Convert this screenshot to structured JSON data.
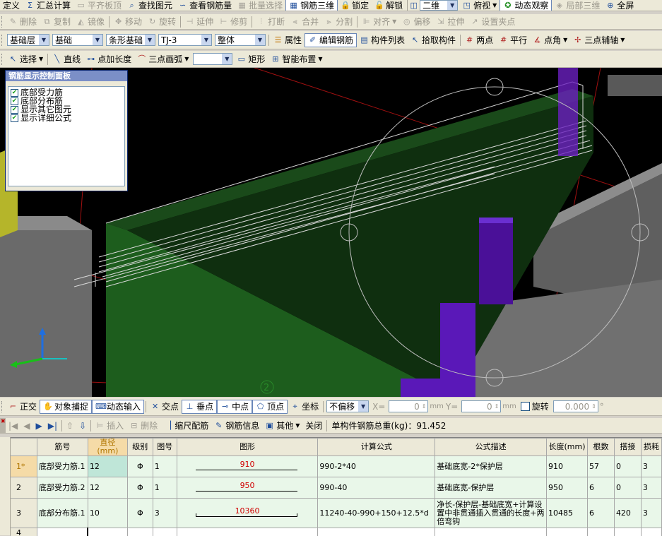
{
  "menu_toolbar": {
    "items": [
      "定义",
      "汇总计算",
      "平齐板顶",
      "查找图元",
      "查看钢筋量",
      "批量选择",
      "钢筋三维",
      "锁定",
      "解锁"
    ],
    "view_mode": "二维",
    "view_angle": "俯视",
    "dynamic_observe": "动态观察",
    "local_3d": "局部三维",
    "fullscreen": "全屏"
  },
  "edit_toolbar": {
    "items": [
      "删除",
      "复制",
      "镜像",
      "移动",
      "旋转",
      "延伸",
      "修剪",
      "打断",
      "合并",
      "分割",
      "对齐",
      "偏移",
      "拉伸",
      "设置夹点"
    ]
  },
  "property_toolbar": {
    "floor": "基础层",
    "category": "基础",
    "type": "条形基础",
    "member": "TJ-3",
    "scope": "整体",
    "items": [
      "属性",
      "编辑钢筋",
      "构件列表",
      "拾取构件",
      "两点",
      "平行",
      "点角",
      "三点辅轴"
    ]
  },
  "draw_toolbar": {
    "items": [
      "选择",
      "直线",
      "点加长度",
      "三点画弧",
      "矩形",
      "智能布置"
    ],
    "shape_select": ""
  },
  "panel": {
    "title": "钢筋显示控制面板",
    "items": [
      "底部受力筋",
      "底部分布筋",
      "显示其它图元",
      "显示详细公式"
    ]
  },
  "viewport": {
    "axis_label": "2"
  },
  "snap_toolbar": {
    "items": [
      "正交",
      "对象捕捉",
      "动态输入",
      "交点",
      "垂点",
      "中点",
      "顶点",
      "坐标"
    ],
    "offset_mode": "不偏移",
    "x_label": "X=",
    "x_value": "0",
    "y_label": "Y=",
    "y_value": "0",
    "unit": "mm",
    "rotate_label": "旋转",
    "rotate_value": "0.000",
    "degree": "°"
  },
  "rebar_toolbar": {
    "items": [
      "插入",
      "删除",
      "缩尺配筋",
      "钢筋信息",
      "其他",
      "关闭"
    ],
    "total_weight": "单构件钢筋总重(kg)：91.452"
  },
  "table": {
    "headers": [
      "筋号",
      "直径(mm)",
      "级别",
      "图号",
      "图形",
      "计算公式",
      "公式描述",
      "长度(mm)",
      "根数",
      "搭接",
      "损耗"
    ],
    "rows": [
      {
        "no": "1*",
        "name": "底部受力筋.1",
        "diameter": "12",
        "grade": "Φ",
        "fig": "1",
        "shape": "910",
        "formula": "990-2*40",
        "desc": "基础底宽-2*保护层",
        "length": "910",
        "count": "57",
        "lap": "0",
        "loss": "3"
      },
      {
        "no": "2",
        "name": "底部受力筋.2",
        "diameter": "12",
        "grade": "Φ",
        "fig": "1",
        "shape": "950",
        "formula": "990-40",
        "desc": "基础底宽-保护层",
        "length": "950",
        "count": "6",
        "lap": "0",
        "loss": "3"
      },
      {
        "no": "3",
        "name": "底部分布筋.1",
        "diameter": "10",
        "grade": "Φ",
        "fig": "3",
        "shape": "10360",
        "formula": "11240-40-990+150+12.5*d",
        "desc": "净长-保护层-基础底宽+计算设置中非贯通插入贯通的长度+两倍弯钩",
        "length": "10485",
        "count": "6",
        "lap": "420",
        "loss": "3"
      },
      {
        "no": "4",
        "name": "",
        "diameter": "",
        "grade": "",
        "fig": "",
        "shape": "",
        "formula": "",
        "desc": "",
        "length": "",
        "count": "",
        "lap": "",
        "loss": ""
      }
    ]
  }
}
